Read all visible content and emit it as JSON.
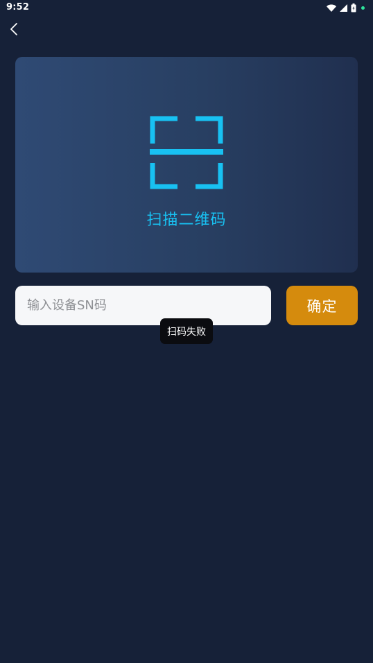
{
  "status_bar": {
    "time": "9:52",
    "icons": [
      "wifi-icon",
      "signal-icon",
      "battery-icon",
      "notification-dot"
    ],
    "dot_color": "#2ee59d"
  },
  "nav": {
    "back_icon": "chevron-left-icon"
  },
  "scan": {
    "label": "扫描二维码",
    "icon": "qr-scan-icon",
    "accent_color": "#18c1f2"
  },
  "sn_input": {
    "value": "",
    "placeholder": "输入设备SN码"
  },
  "confirm": {
    "label": "确定",
    "color": "#d58b0d"
  },
  "toast": {
    "message": "扫码失败"
  }
}
